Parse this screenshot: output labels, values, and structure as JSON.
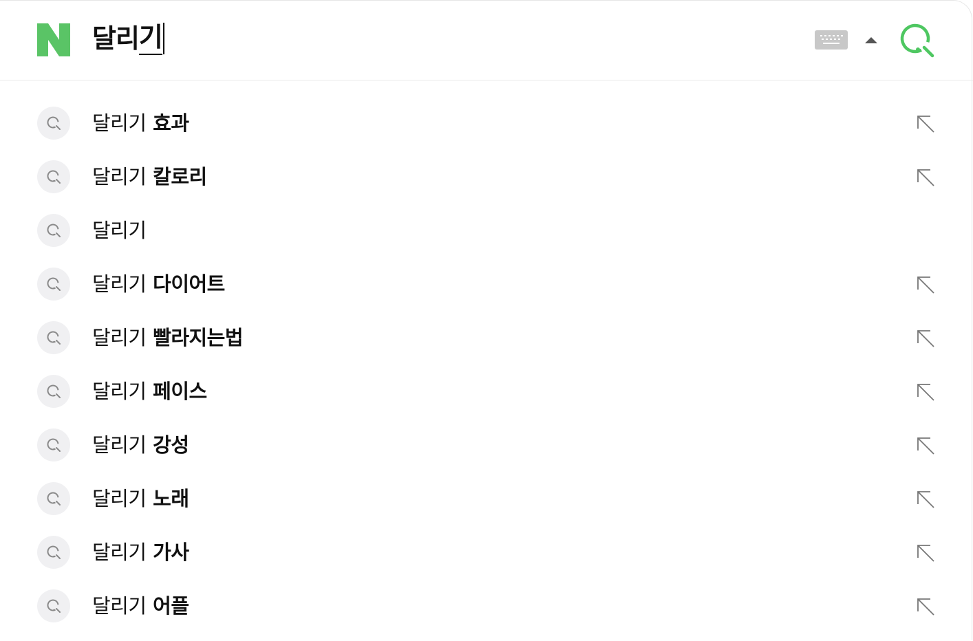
{
  "search": {
    "query_committed": "달리",
    "query_composing": "기"
  },
  "header": {
    "logo_letter": "N",
    "brand_color": "#03c75a",
    "icons": {
      "logo": "naver-n-logo",
      "keyboard": "keyboard-icon",
      "collapse": "caret-up-icon",
      "search": "search-icon"
    }
  },
  "suggestions": [
    {
      "prefix": "달리기",
      "rest": " 효과",
      "fill_arrow": true
    },
    {
      "prefix": "달리기",
      "rest": " 칼로리",
      "fill_arrow": true
    },
    {
      "prefix": "달리기",
      "rest": "",
      "fill_arrow": false
    },
    {
      "prefix": "달리기",
      "rest": " 다이어트",
      "fill_arrow": true
    },
    {
      "prefix": "달리기",
      "rest": " 빨라지는법",
      "fill_arrow": true
    },
    {
      "prefix": "달리기",
      "rest": " 페이스",
      "fill_arrow": true
    },
    {
      "prefix": "달리기",
      "rest": " 강성",
      "fill_arrow": true
    },
    {
      "prefix": "달리기",
      "rest": " 노래",
      "fill_arrow": true
    },
    {
      "prefix": "달리기",
      "rest": " 가사",
      "fill_arrow": true
    },
    {
      "prefix": "달리기",
      "rest": " 어플",
      "fill_arrow": true
    }
  ],
  "colors": {
    "text": "#111111",
    "icon_gray": "#888888",
    "item_icon_bg": "#f0f0f2"
  }
}
